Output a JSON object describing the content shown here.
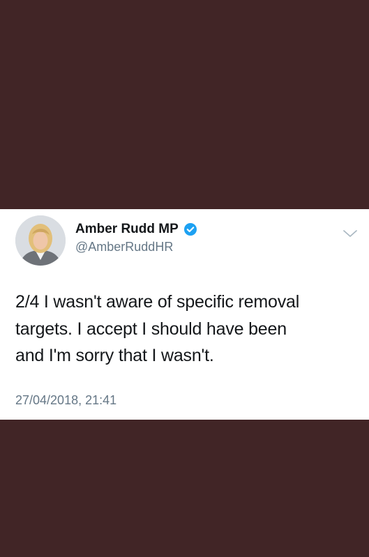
{
  "tweet": {
    "author": {
      "name": "Amber Rudd MP",
      "handle": "@AmberRuddHR",
      "verified": true
    },
    "text_lines": [
      "2/4 I wasn't aware of specific removal",
      "targets. I accept I should have been",
      "and I'm sorry that I wasn't."
    ],
    "timestamp": "27/04/2018, 21:41"
  },
  "icons": {
    "verified": "verified-badge-icon",
    "menu": "chevron-down-icon"
  },
  "colors": {
    "background": "#412526",
    "card": "#ffffff",
    "text": "#14171a",
    "muted": "#657786",
    "verified": "#1da1f2"
  }
}
